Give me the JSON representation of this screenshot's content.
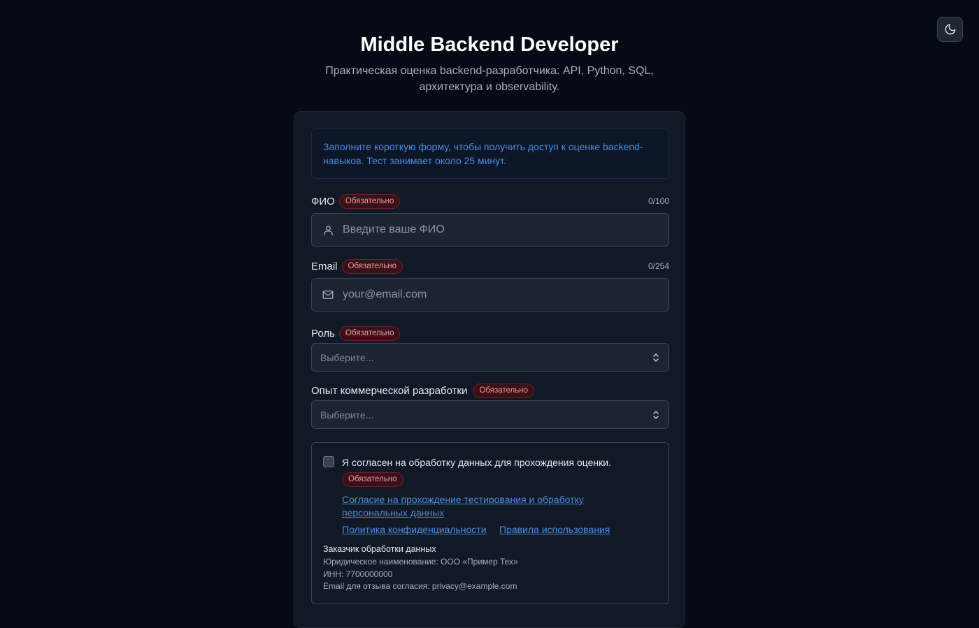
{
  "header": {
    "title": "Middle Backend Developer",
    "subtitle": "Практическая оценка backend-разработчика: API, Python, SQL, архитектура и observability."
  },
  "theme_toggle": {
    "icon": "moon-icon"
  },
  "info": {
    "text": "Заполните короткую форму, чтобы получить доступ к оценке backend-навыков. Тест занимает около 25 минут."
  },
  "form": {
    "required_label": "Обязательно",
    "full_name": {
      "label": "ФИО",
      "counter": "0/100",
      "placeholder": "Введите ваше ФИО",
      "value": "",
      "icon": "user-icon"
    },
    "email": {
      "label": "Email",
      "counter": "0/254",
      "placeholder": "your@email.com",
      "value": "",
      "icon": "mail-icon"
    },
    "role": {
      "label": "Роль",
      "selected": "Выберите..."
    },
    "experience": {
      "label": "Опыт коммерческой разработки",
      "selected": "Выберите..."
    },
    "consent": {
      "checked": false,
      "text": "Я согласен на обработку данных для прохождения оценки.",
      "link_consent_line1": "Согласие на прохождение тестирования и обработку",
      "link_consent_line2": "персональных данных",
      "link_privacy": "Политика конфиденциальности",
      "link_terms": "Правила использования",
      "customer_title": "Заказчик обработки данных",
      "customer_legal_name": "Юридическое наименование: ООО «Пример Тех»",
      "customer_inn": "ИНН: 7700000000",
      "customer_email": "Email для отзыва согласия: privacy@example.com"
    }
  },
  "colors": {
    "background": "#060a14",
    "card": "#111826",
    "accent_link": "#4c8ddf",
    "required_badge_bg": "#3a1118",
    "required_badge_text": "#ef9aa1"
  }
}
